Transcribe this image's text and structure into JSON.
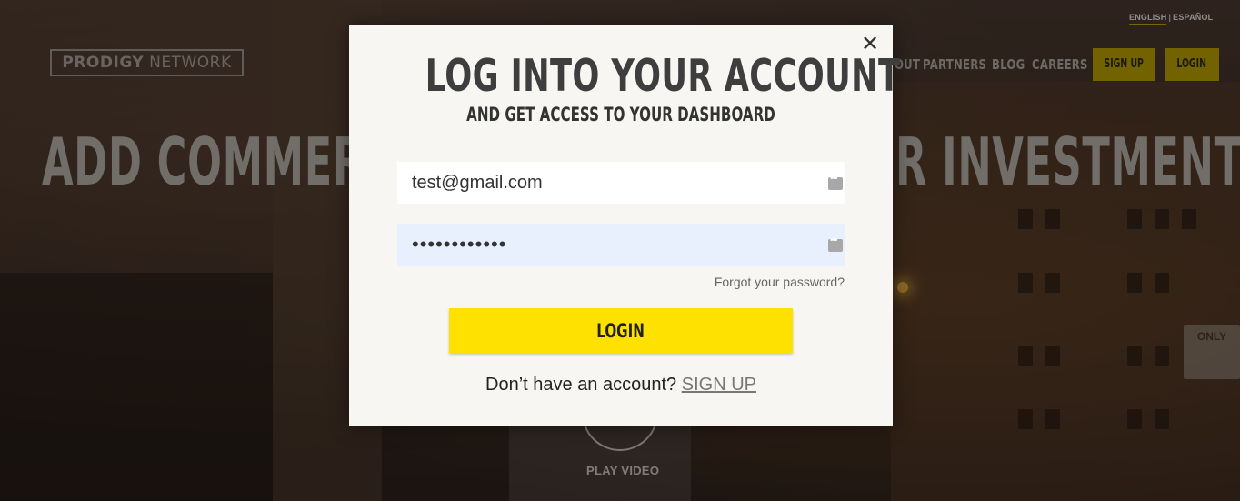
{
  "header": {
    "logo_bold": "PRODIGY",
    "logo_light": "NETWORK",
    "lang_english": "ENGLISH",
    "lang_spanish": "ESPAÑOL",
    "nav_items": [
      "OUT",
      "PARTNERS",
      "BLOG",
      "CAREERS"
    ],
    "signup_label": "SIGN UP",
    "login_label": "LOGIN"
  },
  "hero": {
    "left_text": "ADD COMMERC",
    "right_text": "R INVESTMENT",
    "play_label": "PLAY VIDEO"
  },
  "modal": {
    "title": "LOG INTO YOUR ACCOUNT",
    "subtitle": "AND GET ACCESS TO YOUR DASHBOARD",
    "email_value": "test@gmail.com",
    "password_value": "••••••••••••",
    "forgot_label": "Forgot your password?",
    "login_label": "LOGIN",
    "no_account_text": "Don’t have an account?",
    "signup_link": "SIGN UP",
    "close_icon": "close-icon"
  },
  "background": {
    "sign_text": "ONLY"
  },
  "colors": {
    "accent_yellow": "#ffe100",
    "nav_button_yellow": "#b8a000",
    "password_autofill_bg": "#e8f0fe",
    "modal_bg": "#f7f6f2"
  }
}
